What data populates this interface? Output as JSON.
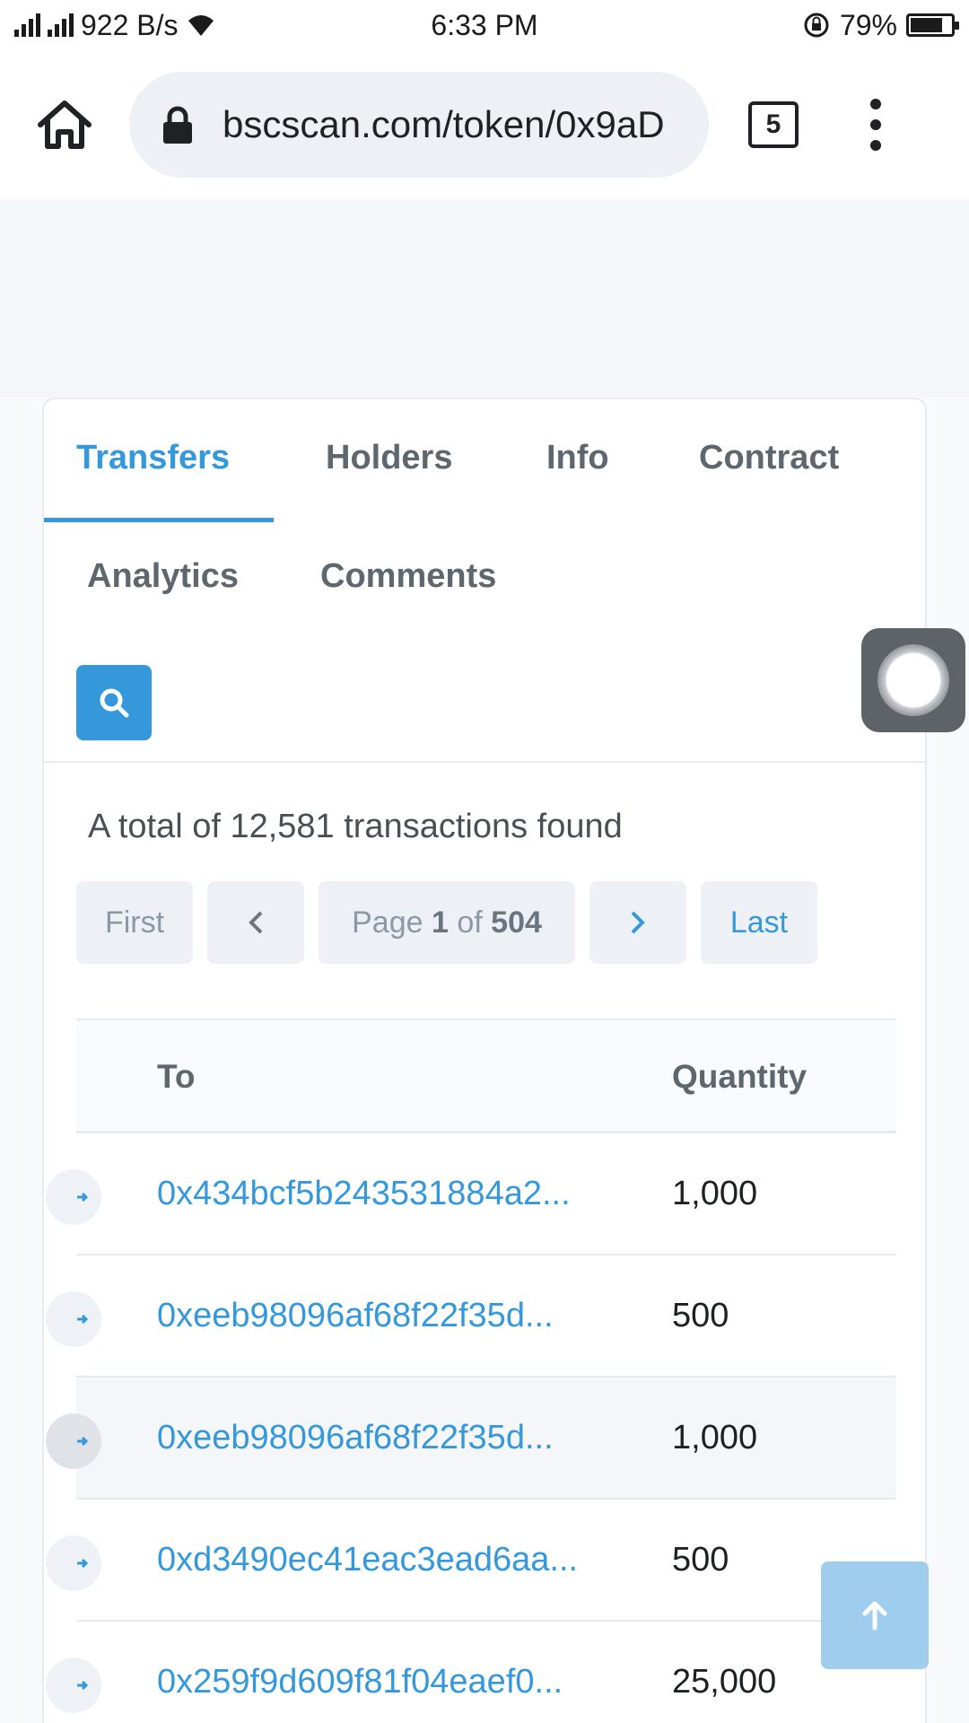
{
  "status_bar": {
    "net_speed": "922 B/s",
    "time": "6:33 PM",
    "battery": "79%",
    "battery_level": 0.79
  },
  "browser": {
    "url": "bscscan.com/token/0x9aD",
    "tab_count": "5"
  },
  "tabs": [
    "Transfers",
    "Holders",
    "Info",
    "Contract",
    "Analytics",
    "Comments"
  ],
  "active_tab": "Transfers",
  "summary": "A total of 12,581 transactions found",
  "pager": {
    "first": "First",
    "page_prefix": "Page",
    "current_page": "1",
    "of_label": "of",
    "total_pages": "504",
    "last": "Last"
  },
  "table": {
    "headers": {
      "to": "To",
      "quantity": "Quantity"
    },
    "rows": [
      {
        "to": "0x434bcf5b243531884a2...",
        "quantity": "1,000"
      },
      {
        "to": "0xeeb98096af68f22f35d...",
        "quantity": "500"
      },
      {
        "to": "0xeeb98096af68f22f35d...",
        "quantity": "1,000"
      },
      {
        "to": "0xd3490ec41eac3ead6aa...",
        "quantity": "500"
      },
      {
        "to": "0x259f9d609f81f04eaef0...",
        "quantity": "25,000"
      }
    ]
  },
  "colors": {
    "accent": "#3498db",
    "tab_text": "#5f676e",
    "back_to_top": "#9ecdee"
  }
}
